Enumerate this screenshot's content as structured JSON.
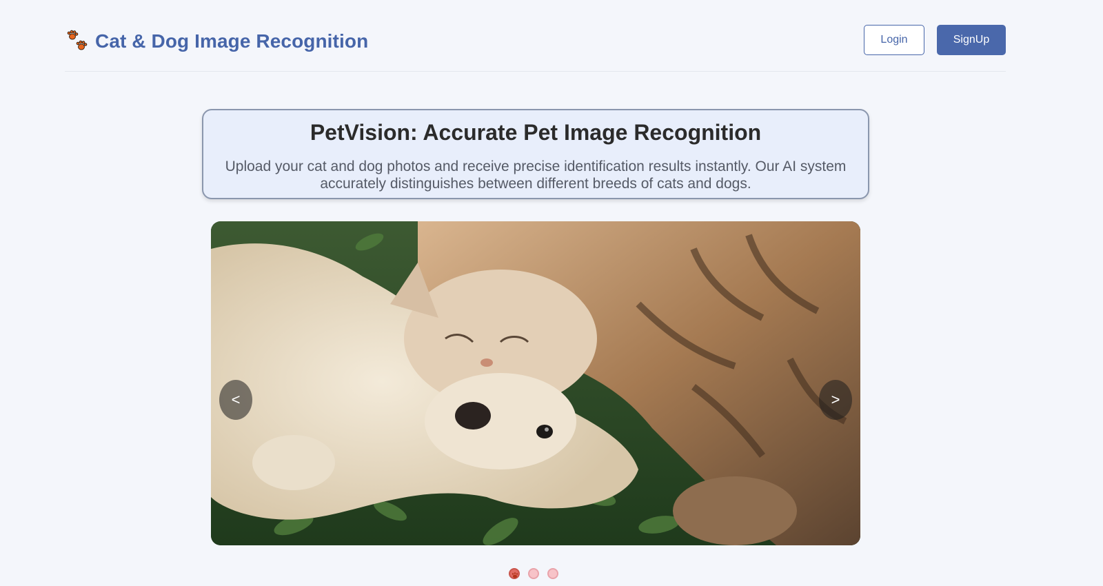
{
  "header": {
    "brand_title": "Cat & Dog Image Recognition",
    "brand_icon": "paw-prints-icon",
    "login_label": "Login",
    "signup_label": "SignUp"
  },
  "hero": {
    "title": "PetVision: Accurate Pet Image Recognition",
    "description": "Upload your cat and dog photos and receive precise identification results instantly. Our AI system accurately distinguishes between different breeds of cats and dogs."
  },
  "carousel": {
    "image_subject": "cat-and-dog-lying-in-grass",
    "prev_label": "<",
    "next_label": ">",
    "slide_count": 3,
    "active_index": 0
  },
  "colors": {
    "brand": "#4665a9",
    "background": "#f4f6fb",
    "hero_background": "#e8eefb",
    "dot_active": "#e06b63",
    "dot_inactive": "#f7c3c8"
  }
}
